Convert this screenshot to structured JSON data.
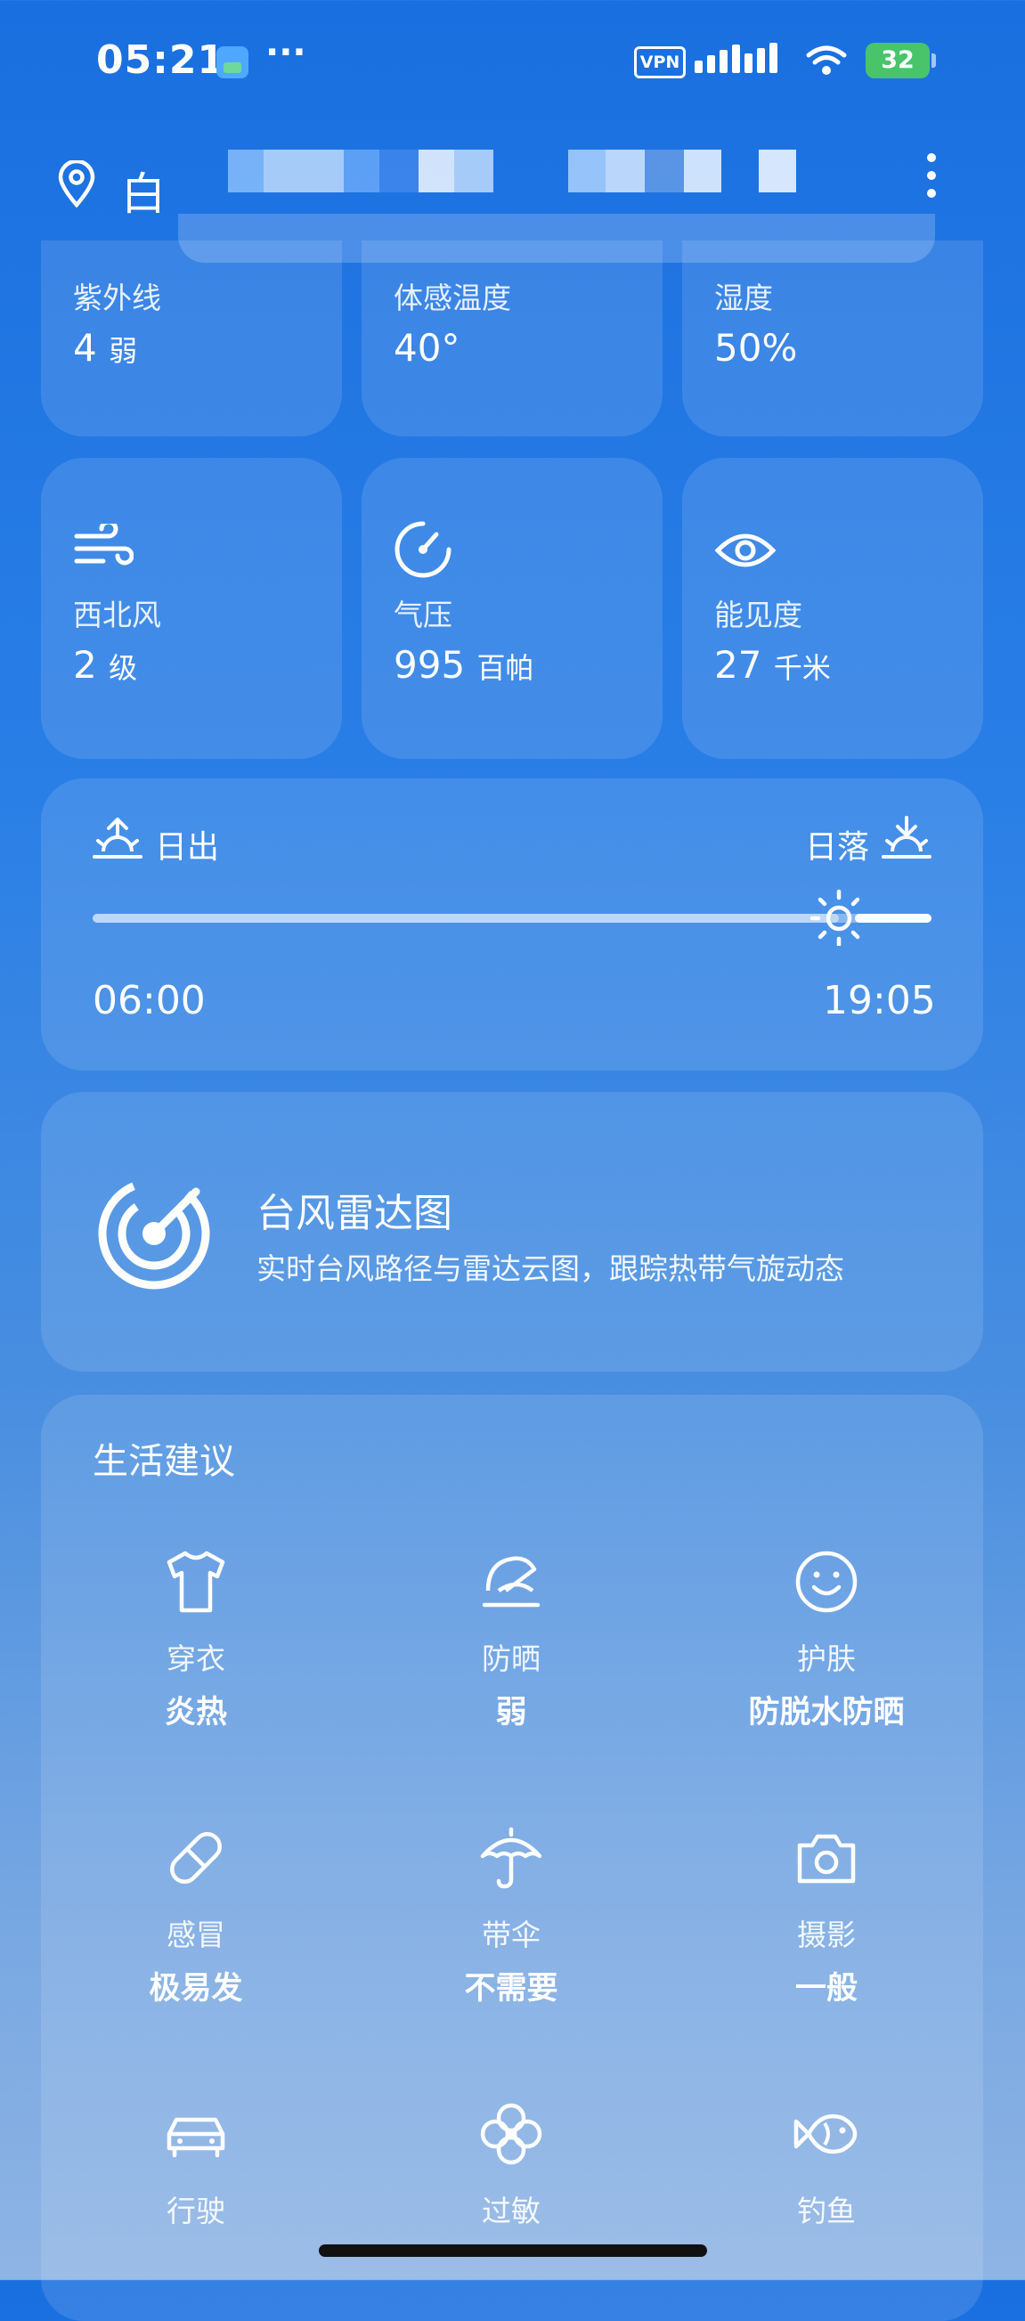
{
  "status_bar": {
    "time": "05:21",
    "more": "···",
    "vpn": "VPN",
    "battery": "32"
  },
  "header": {
    "location": "白",
    "location_redacted": true
  },
  "metrics_row1": [
    {
      "label": "紫外线",
      "value": "4",
      "unit": "弱"
    },
    {
      "label": "体感温度",
      "value": "40°",
      "unit": ""
    },
    {
      "label": "湿度",
      "value": "50%",
      "unit": ""
    }
  ],
  "metrics_row2": [
    {
      "label": "西北风",
      "value": "2",
      "unit": "级",
      "icon": "wind-icon"
    },
    {
      "label": "气压",
      "value": "995",
      "unit": "百帕",
      "icon": "pressure-gauge-icon"
    },
    {
      "label": "能见度",
      "value": "27",
      "unit": "千米",
      "icon": "eye-icon"
    }
  ],
  "sun": {
    "sunrise_label": "日出",
    "sunset_label": "日落",
    "sunrise_time": "06:00",
    "sunset_time": "19:05",
    "progress_fraction": 0.89
  },
  "typhoon": {
    "title": "台风雷达图",
    "subtitle": "实时台风路径与雷达云图，跟踪热带气旋动态",
    "icon": "radar-icon"
  },
  "life": {
    "title": "生活建议",
    "items": [
      {
        "label": "穿衣",
        "value": "炎热",
        "icon": "tshirt-icon"
      },
      {
        "label": "防晒",
        "value": "弱",
        "icon": "sun-hat-icon"
      },
      {
        "label": "护肤",
        "value": "防脱水防晒",
        "icon": "smile-icon"
      },
      {
        "label": "感冒",
        "value": "极易发",
        "icon": "pill-icon"
      },
      {
        "label": "带伞",
        "value": "不需要",
        "icon": "umbrella-icon"
      },
      {
        "label": "摄影",
        "value": "一般",
        "icon": "camera-icon"
      },
      {
        "label": "行驶",
        "value": "",
        "icon": "car-icon"
      },
      {
        "label": "过敏",
        "value": "",
        "icon": "flower-icon"
      },
      {
        "label": "钓鱼",
        "value": "",
        "icon": "fish-icon"
      }
    ]
  },
  "colors": {
    "bg_top": "#1a6fe0",
    "bg_bottom": "#8eb4e4",
    "card": "rgba(255,255,255,0.12)",
    "battery": "#49c46a"
  }
}
